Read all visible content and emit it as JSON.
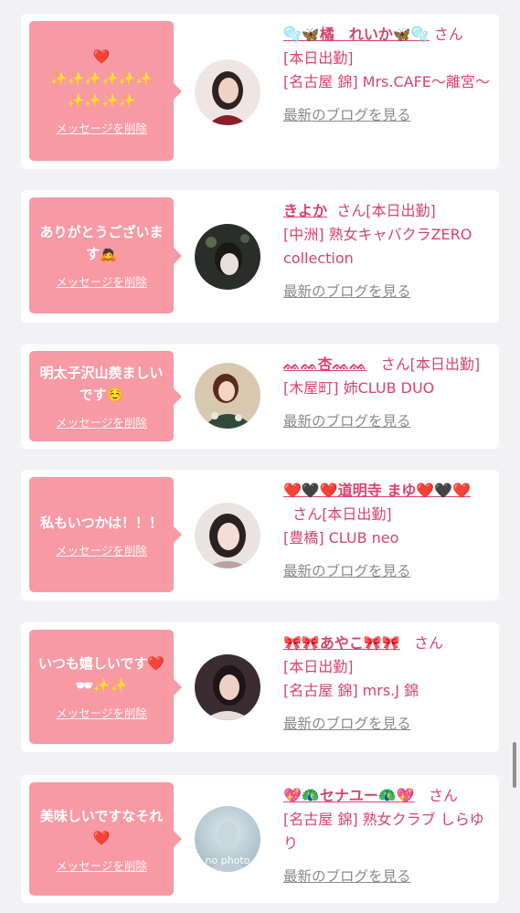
{
  "common": {
    "delete_label": "メッセージを削除",
    "blog_label": "最新のブログを見る"
  },
  "cards": [
    {
      "message": "❤️\n✨✨✨✨✨✨\n✨✨✨✨",
      "name": "🫧🦋橘　れいか🦋🫧",
      "san": "さん",
      "status": "[本日出勤]",
      "shop": "[名古屋 錦] Mrs.CAFE～離宮～"
    },
    {
      "message": "ありがとうございます🙇",
      "name": "きよか",
      "san": "さん",
      "status": "[本日出勤]",
      "shop": "[中洲] 熟女キャバクラZERO collection"
    },
    {
      "message": "明太子沢山羨ましいです☺️",
      "name": "ᨐᨐ杏ᨐᨐ",
      "san": "さん",
      "status": "[本日出勤]",
      "shop": "[木屋町] 姉CLUB DUO"
    },
    {
      "message": "私もいつかは！！！",
      "name": "❤️🖤❤️道明寺 まゆ❤️🖤❤️",
      "san": "さん",
      "status": "[本日出勤]",
      "shop": "[豊橋] CLUB neo"
    },
    {
      "message": "いつも嬉しいです❤️🕶✨✨",
      "name": "🎀🎀あやこ🎀🎀",
      "san": "さん",
      "status": "[本日出勤]",
      "shop": "[名古屋 錦] mrs.J 錦"
    },
    {
      "message": "美味しいですなそれ❤️",
      "name": "💖🦚セナユー🦚💖",
      "san": "さん",
      "status": "",
      "shop": "[名古屋 錦] 熟女クラブ しらゆり",
      "avatar_text": "no photo"
    }
  ],
  "colors": {
    "bubble": "#f79aa4",
    "accent": "#d8436e",
    "muted": "#8a8a8a",
    "background": "#f2f2f4"
  }
}
